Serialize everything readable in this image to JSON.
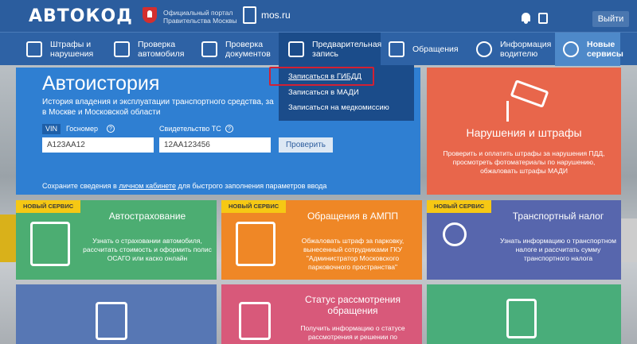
{
  "header": {
    "logo": "АВТОКОД",
    "portal_line1": "Официальный портал",
    "portal_line2": "Правительства Москвы",
    "mosru": "mos.ru",
    "logout": "Выйти"
  },
  "nav": [
    {
      "line1": "Штрафы и",
      "line2": "нарушения",
      "icon": "fine-receipt-icon"
    },
    {
      "line1": "Проверка",
      "line2": "автомобиля",
      "icon": "car-check-icon"
    },
    {
      "line1": "Проверка",
      "line2": "документов",
      "icon": "document-check-icon"
    },
    {
      "line1": "Предварительная",
      "line2": "запись",
      "icon": "calendar-icon"
    },
    {
      "line1": "Обращения",
      "line2": "",
      "icon": "appeal-icon"
    },
    {
      "line1": "Информация",
      "line2": "водителю",
      "icon": "question-icon"
    },
    {
      "line1": "Новые",
      "line2": "сервисы",
      "icon": "exclamation-icon"
    }
  ],
  "dropdown": [
    "Записаться в ГИБДД",
    "Записаться в МАДИ",
    "Записаться на медкомиссию"
  ],
  "autohistory": {
    "title": "Автоистория",
    "desc_line1": "История владения и эксплуатации транспортного средства, за",
    "desc_line2": "в Москве и Московской области",
    "tab_vin": "VIN",
    "tab_gos": "Госномер",
    "sts_label": "Свидетельство ТС",
    "vin_value": "А123АА12",
    "sts_value": "12АА123456",
    "button": "Проверить",
    "footer_pre": "Сохраните сведения в",
    "footer_link": "личном кабинете",
    "footer_post": "для быстрого заполнения параметров ввода"
  },
  "violations": {
    "title": "Нарушения и штрафы",
    "desc": "Проверить и оплатить штрафы за нарушения ПДД, просмотреть фотоматериалы по нарушению, обжаловать штрафы МАДИ"
  },
  "tiles": [
    {
      "badge": "НОВЫЙ СЕРВИС",
      "title": "Автострахование",
      "desc": "Узнать о страховании автомобиля, рассчитать стоимость и оформить полис ОСАГО или каско онлайн",
      "color": "#4cad72",
      "icon": "shield-check-icon"
    },
    {
      "badge": "НОВЫЙ СЕРВИС",
      "title": "Обращения в АМПП",
      "desc": "Обжаловать штраф за парковку, вынесенный сотрудниками ГКУ \"Администратор Московского парковочного пространства\"",
      "color": "#ef8726",
      "icon": "parking-appeal-icon"
    },
    {
      "badge": "НОВЫЙ СЕРВИС",
      "title": "Транспортный налог",
      "desc": "Узнать информацию о транспортном налоге и рассчитать сумму транспортного налога",
      "color": "#5766ad",
      "icon": "car-tax-icon"
    },
    {
      "badge": "",
      "title": "",
      "desc": "",
      "color": "#5777b4",
      "icon": "documents-alert-icon"
    },
    {
      "badge": "",
      "title": "Статус рассмотрения обращения",
      "desc": "Получить информацию о статусе рассмотрения и решении по",
      "color": "#d8597a",
      "icon": "document-search-icon"
    },
    {
      "badge": "",
      "title": "",
      "desc": "",
      "color": "#49ad7a",
      "icon": "checklist-icon"
    }
  ]
}
